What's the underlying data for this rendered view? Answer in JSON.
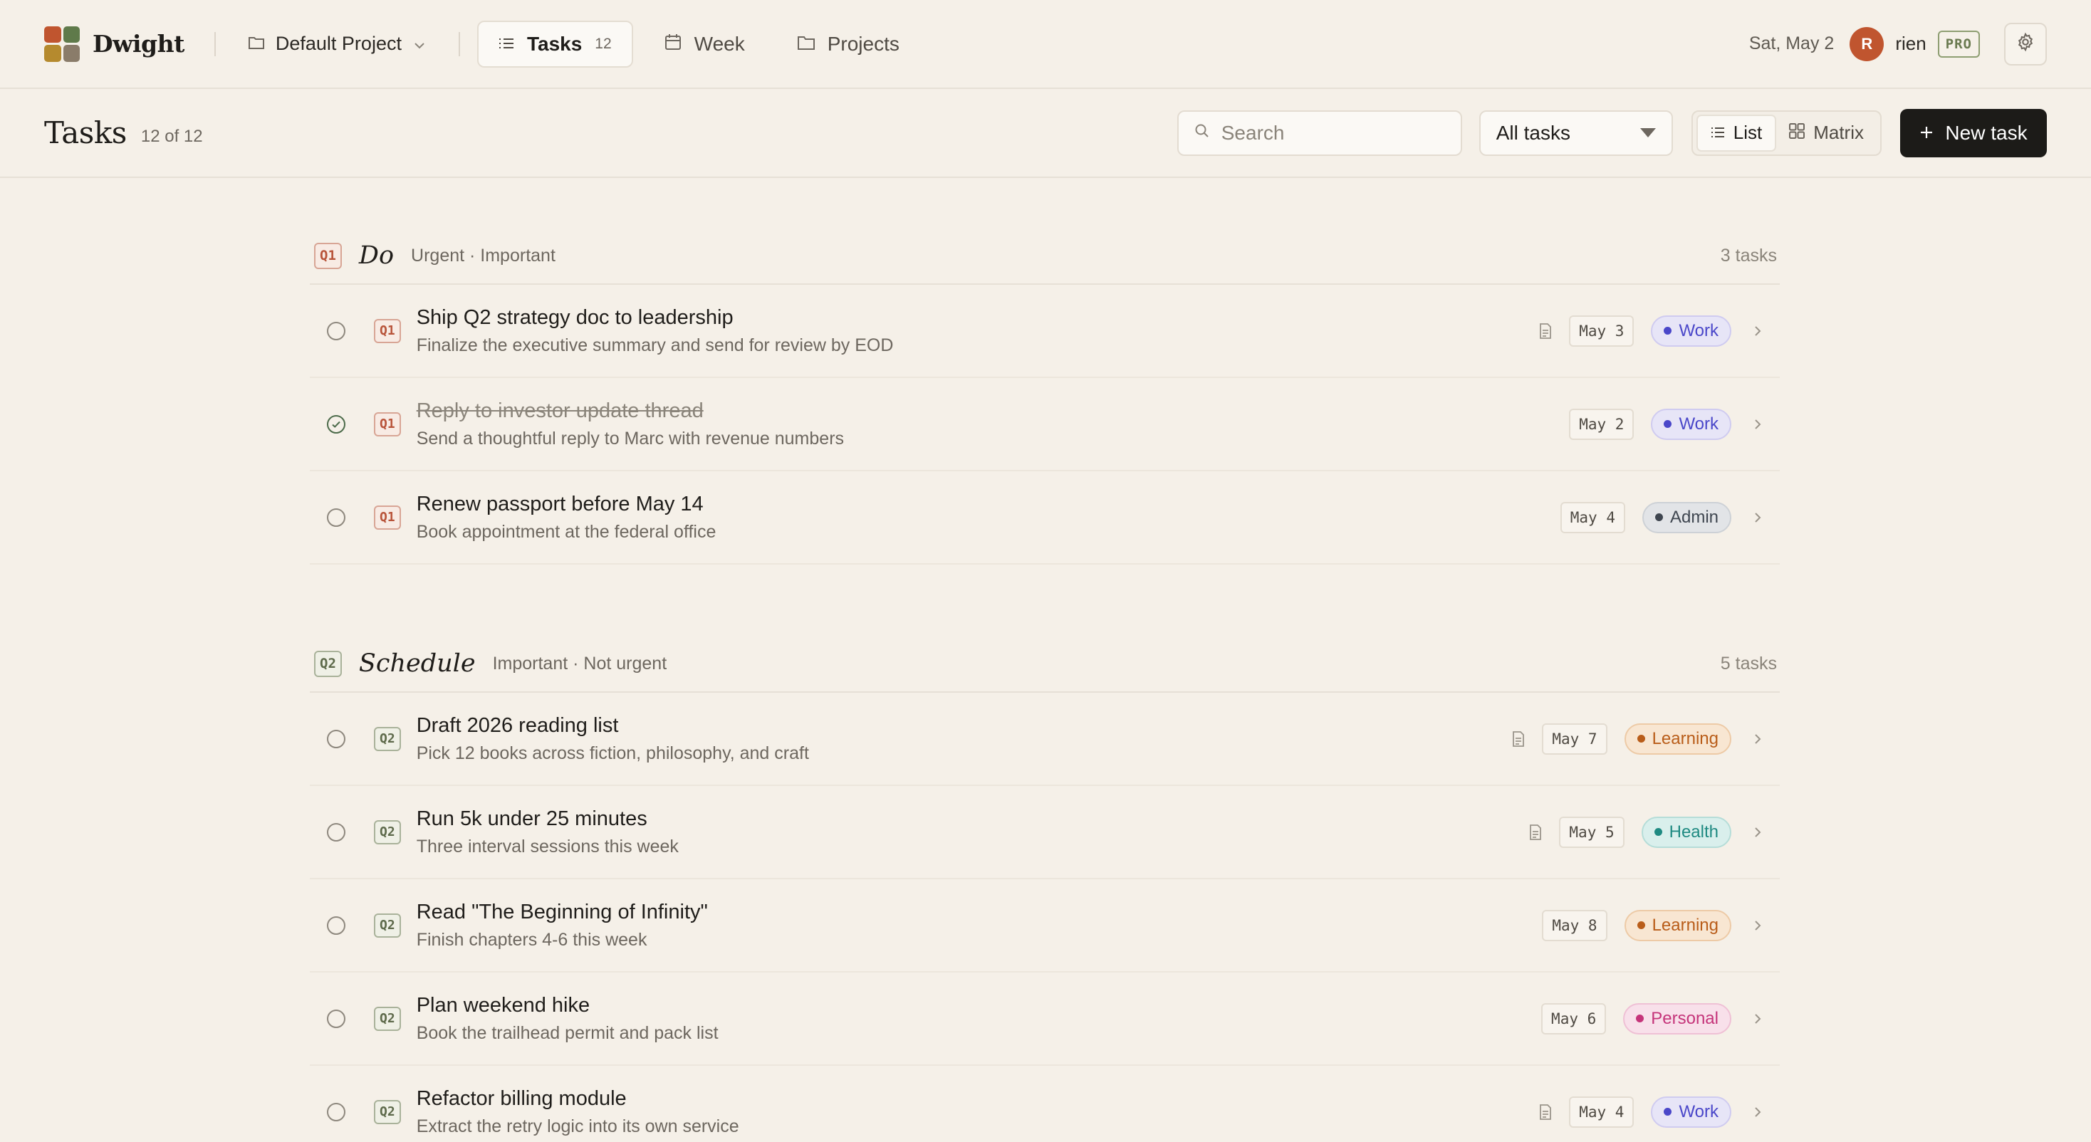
{
  "app": {
    "name": "Dwight",
    "logo_colors": [
      "#c0552f",
      "#5f7a4a",
      "#b58a2e",
      "#8a7c6a"
    ],
    "project": "Default Project",
    "nav": [
      {
        "label": "Tasks",
        "count": "12",
        "icon": "list-icon",
        "active": true
      },
      {
        "label": "Week",
        "icon": "calendar-icon",
        "active": false
      },
      {
        "label": "Projects",
        "icon": "folder-icon",
        "active": false
      }
    ],
    "date": "Sat, May 2",
    "user": {
      "initial": "R",
      "name": "rien",
      "plan": "PRO"
    }
  },
  "toolbar": {
    "title": "Tasks",
    "count": "12 of 12",
    "search_placeholder": "Search",
    "filter": "All tasks",
    "view_list": "List",
    "view_matrix": "Matrix",
    "new_task": "New task"
  },
  "colors": {
    "Work": {
      "fg": "#4a47c9",
      "bg": "#e7e5f7",
      "border": "#cfcbf0"
    },
    "Admin": {
      "fg": "#3f4650",
      "bg": "#e2e4e7",
      "border": "#cdd1d6"
    },
    "Learning": {
      "fg": "#b95d1a",
      "bg": "#f8e6d2",
      "border": "#edcaa6"
    },
    "Health": {
      "fg": "#1f8a82",
      "bg": "#d9efec",
      "border": "#b5ddd8"
    },
    "Personal": {
      "fg": "#c5347a",
      "bg": "#f8e0ea",
      "border": "#efc0d5"
    }
  },
  "groups": [
    {
      "badge": "Q1",
      "name": "Do",
      "desc": "Urgent · Important",
      "count": "3 tasks",
      "tasks": [
        {
          "title": "Ship Q2 strategy doc to leadership",
          "sub": "Finalize the executive summary and send for review by EOD",
          "due": "May 3",
          "tag": "Work",
          "note": true,
          "done": false
        },
        {
          "title": "Reply to investor update thread",
          "sub": "Send a thoughtful reply to Marc with revenue numbers",
          "due": "May 2",
          "tag": "Work",
          "note": false,
          "done": true
        },
        {
          "title": "Renew passport before May 14",
          "sub": "Book appointment at the federal office",
          "due": "May 4",
          "tag": "Admin",
          "note": false,
          "done": false
        }
      ]
    },
    {
      "badge": "Q2",
      "name": "Schedule",
      "desc": "Important · Not urgent",
      "count": "5 tasks",
      "tasks": [
        {
          "title": "Draft 2026 reading list",
          "sub": "Pick 12 books across fiction, philosophy, and craft",
          "due": "May 7",
          "tag": "Learning",
          "note": true,
          "done": false
        },
        {
          "title": "Run 5k under 25 minutes",
          "sub": "Three interval sessions this week",
          "due": "May 5",
          "tag": "Health",
          "note": true,
          "done": false
        },
        {
          "title": "Read \"The Beginning of Infinity\"",
          "sub": "Finish chapters 4-6 this week",
          "due": "May 8",
          "tag": "Learning",
          "note": false,
          "done": false
        },
        {
          "title": "Plan weekend hike",
          "sub": "Book the trailhead permit and pack list",
          "due": "May 6",
          "tag": "Personal",
          "note": false,
          "done": false
        },
        {
          "title": "Refactor billing module",
          "sub": "Extract the retry logic into its own service",
          "due": "May 4",
          "tag": "Work",
          "note": true,
          "done": false
        }
      ]
    }
  ]
}
